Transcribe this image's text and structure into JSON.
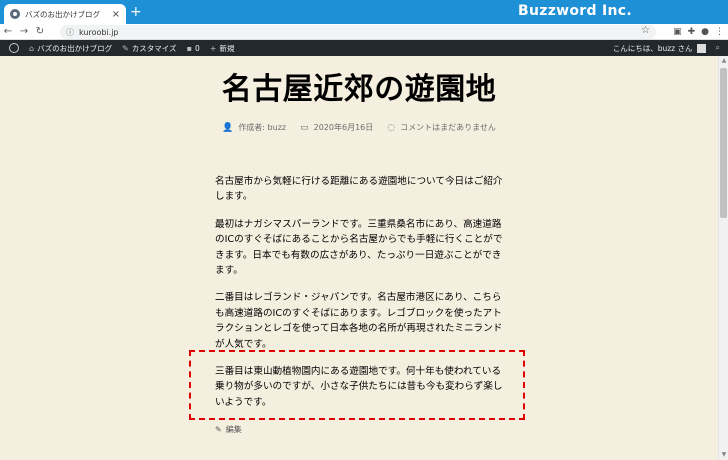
{
  "browser": {
    "tab_title": "バズのお出かけブログ",
    "tab_close": "×",
    "new_tab": "+",
    "brand": "Buzzword Inc.",
    "url": "kuroobi.jp"
  },
  "adminbar": {
    "site_name": "バズのお出かけブログ",
    "customize": "カスタマイズ",
    "comments_count": "0",
    "new": "新規",
    "greeting": "こんにちは、buzz さん"
  },
  "post": {
    "title": "名古屋近郊の遊園地",
    "author": "作成者: buzz",
    "date": "2020年6月16日",
    "comments": "コメントはまだありません",
    "paragraphs": [
      "名古屋市から気軽に行ける距離にある遊園地について今日はご紹介します。",
      "最初はナガシマスパーランドです。三重県桑名市にあり、高速道路のICのすぐそばにあることから名古屋からでも手軽に行くことができます。日本でも有数の広さがあり、たっぷり一日遊ぶことができます。",
      "二番目はレゴランド・ジャパンです。名古屋市港区にあり、こちらも高速道路のICのすぐそばにあります。レゴブロックを使ったアトラクションとレゴを使って日本各地の名所が再現されたミニランドが人気です。",
      "三番目は東山動植物園内にある遊園地です。何十年も使われている乗り物が多いのですが、小さな子供たちには昔も今も変わらず楽しいようです。"
    ],
    "edit": "編集"
  },
  "colors": {
    "titlebar": "#1e90d6",
    "adminbar": "#23282d",
    "page_bg": "#f5efe0",
    "highlight": "#e00000"
  }
}
